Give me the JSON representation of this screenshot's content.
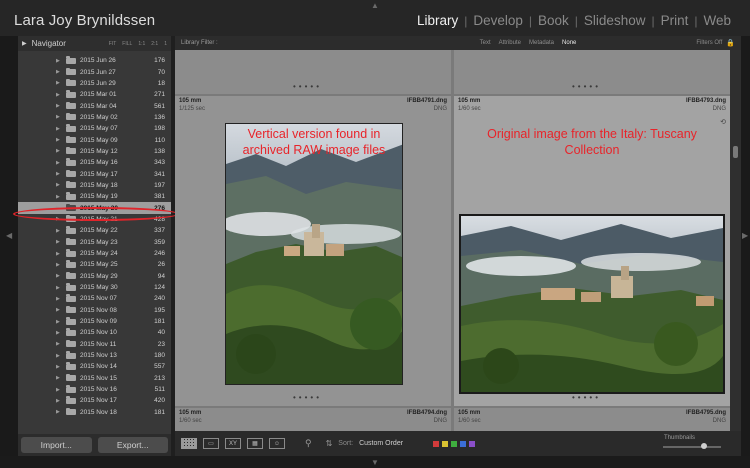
{
  "identity": "Lara Joy Brynildssen",
  "modules": [
    {
      "label": "Library",
      "active": true
    },
    {
      "label": "Develop",
      "active": false
    },
    {
      "label": "Book",
      "active": false
    },
    {
      "label": "Slideshow",
      "active": false
    },
    {
      "label": "Print",
      "active": false
    },
    {
      "label": "Web",
      "active": false
    }
  ],
  "navigator": {
    "title": "Navigator",
    "zoom": [
      "FIT",
      "FILL",
      "1:1",
      "2:1",
      "1"
    ]
  },
  "folders": [
    {
      "name": "2015 Jun 26",
      "count": "176",
      "selected": false
    },
    {
      "name": "2015 Jun 27",
      "count": "70",
      "selected": false
    },
    {
      "name": "2015 Jun 29",
      "count": "18",
      "selected": false
    },
    {
      "name": "2015 Mar 01",
      "count": "271",
      "selected": false
    },
    {
      "name": "2015 Mar 04",
      "count": "561",
      "selected": false
    },
    {
      "name": "2015 May 02",
      "count": "136",
      "selected": false
    },
    {
      "name": "2015 May 07",
      "count": "198",
      "selected": false
    },
    {
      "name": "2015 May 09",
      "count": "110",
      "selected": false
    },
    {
      "name": "2015 May 12",
      "count": "138",
      "selected": false
    },
    {
      "name": "2015 May 16",
      "count": "343",
      "selected": false
    },
    {
      "name": "2015 May 17",
      "count": "341",
      "selected": false
    },
    {
      "name": "2015 May 18",
      "count": "197",
      "selected": false
    },
    {
      "name": "2015 May 19",
      "count": "381",
      "selected": false
    },
    {
      "name": "2015 May 20",
      "count": "276",
      "selected": true
    },
    {
      "name": "2015 May 21",
      "count": "428",
      "selected": false
    },
    {
      "name": "2015 May 22",
      "count": "337",
      "selected": false
    },
    {
      "name": "2015 May 23",
      "count": "359",
      "selected": false
    },
    {
      "name": "2015 May 24",
      "count": "246",
      "selected": false
    },
    {
      "name": "2015 May 25",
      "count": "26",
      "selected": false
    },
    {
      "name": "2015 May 29",
      "count": "94",
      "selected": false
    },
    {
      "name": "2015 May 30",
      "count": "124",
      "selected": false
    },
    {
      "name": "2015 Nov 07",
      "count": "240",
      "selected": false
    },
    {
      "name": "2015 Nov 08",
      "count": "195",
      "selected": false
    },
    {
      "name": "2015 Nov 09",
      "count": "181",
      "selected": false
    },
    {
      "name": "2015 Nov 10",
      "count": "40",
      "selected": false
    },
    {
      "name": "2015 Nov 11",
      "count": "23",
      "selected": false
    },
    {
      "name": "2015 Nov 13",
      "count": "180",
      "selected": false
    },
    {
      "name": "2015 Nov 14",
      "count": "557",
      "selected": false
    },
    {
      "name": "2015 Nov 15",
      "count": "213",
      "selected": false
    },
    {
      "name": "2015 Nov 16",
      "count": "511",
      "selected": false
    },
    {
      "name": "2015 Nov 17",
      "count": "420",
      "selected": false
    },
    {
      "name": "2015 Nov 18",
      "count": "181",
      "selected": false
    }
  ],
  "buttons": {
    "import": "Import...",
    "export": "Export..."
  },
  "filter": {
    "label": "Library Filter :",
    "options": [
      {
        "label": "Text",
        "on": false
      },
      {
        "label": "Attribute",
        "on": false
      },
      {
        "label": "Metadata",
        "on": false
      },
      {
        "label": "None",
        "on": true
      }
    ],
    "status": "Filters Off"
  },
  "cells": [
    {
      "focal": "105 mm",
      "file": "IFBB4791.dng",
      "shutter": "1/125 sec",
      "ext": "DNG"
    },
    {
      "focal": "105 mm",
      "file": "IFBB4793.dng",
      "shutter": "1/60 sec",
      "ext": "DNG"
    },
    {
      "focal": "105 mm",
      "file": "IFBB4794.dng",
      "shutter": "1/60 sec",
      "ext": "DNG"
    },
    {
      "focal": "105 mm",
      "file": "IFBB4795.dng",
      "shutter": "1/60 sec",
      "ext": "DNG"
    }
  ],
  "annotations": {
    "left": "Vertical version found in archived RAW image files",
    "right": "Original image from the Italy: Tuscany Collection"
  },
  "toolbar": {
    "sort_label": "Sort:",
    "sort_value": "Custom Order",
    "thumbnails_label": "Thumbnails",
    "swatches": [
      "#d23b3b",
      "#d9c232",
      "#3fae3f",
      "#3b6ed6",
      "#8a4fc9"
    ]
  },
  "colors": {
    "accent_red": "#e0242a",
    "active_module": "#f0f0f0"
  }
}
